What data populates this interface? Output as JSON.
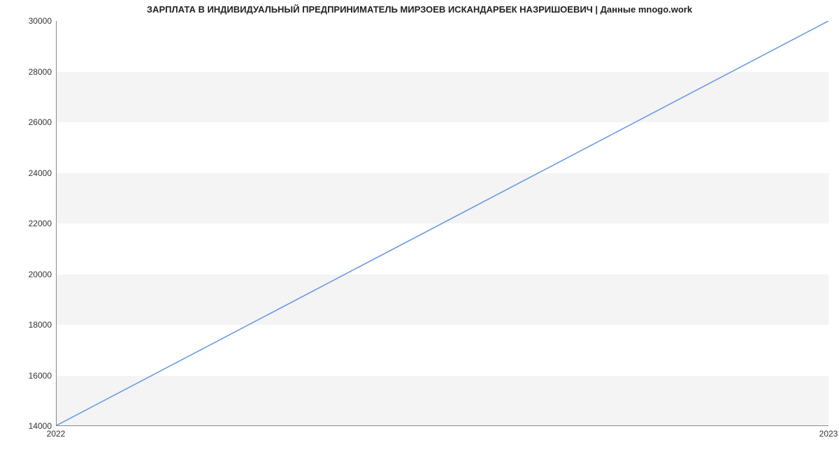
{
  "chart_data": {
    "type": "line",
    "title": "ЗАРПЛАТА В ИНДИВИДУАЛЬНЫЙ ПРЕДПРИНИМАТЕЛЬ МИРЗОЕВ ИСКАНДАРБЕК НАЗРИШОЕВИЧ | Данные mnogo.work",
    "xlabel": "",
    "ylabel": "",
    "x_categories": [
      "2022",
      "2023"
    ],
    "y_ticks": [
      14000,
      16000,
      18000,
      20000,
      22000,
      24000,
      26000,
      28000,
      30000
    ],
    "ylim": [
      14000,
      30000
    ],
    "series": [
      {
        "name": "salary",
        "x": [
          "2022",
          "2023"
        ],
        "values": [
          14000,
          30000
        ]
      }
    ],
    "line_color": "#6a9ae6",
    "grid": true
  }
}
